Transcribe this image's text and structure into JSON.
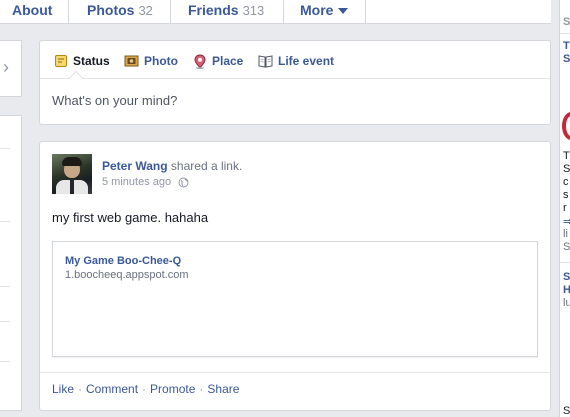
{
  "tabs": [
    {
      "label": "About"
    },
    {
      "label": "Photos",
      "count": "32"
    },
    {
      "label": "Friends",
      "count": "313"
    },
    {
      "label": "More"
    }
  ],
  "composer": {
    "tabs": [
      "Status",
      "Photo",
      "Place",
      "Life event"
    ],
    "placeholder": "What's on your mind?"
  },
  "post": {
    "author": "Peter Wang",
    "action": "shared a link.",
    "time": "5 minutes ago",
    "text": "my first web game. hahaha",
    "link_title": "My Game Boo-Chee-Q",
    "link_url": "1.boocheeq.appspot.com",
    "actions": [
      "Like",
      "Comment",
      "Promote",
      "Share"
    ]
  },
  "right_column": {
    "header": "S",
    "lines": [
      "T",
      "S",
      "T",
      "S",
      "c",
      "s",
      "r",
      "li",
      "S",
      "S",
      "H",
      "lu",
      "S"
    ]
  },
  "colors": {
    "link": "#3b5998",
    "background": "#e9eaed",
    "border": "#d3d6db"
  }
}
